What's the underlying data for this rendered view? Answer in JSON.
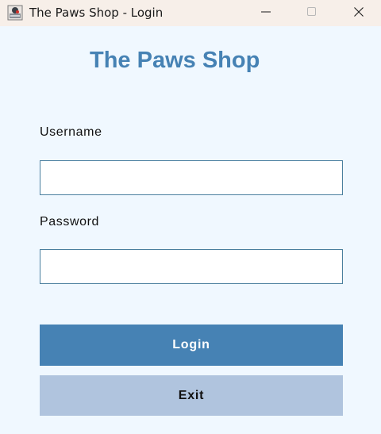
{
  "window": {
    "title": "The Paws Shop - Login"
  },
  "header": {
    "title": "The Paws Shop"
  },
  "form": {
    "username_label": "Username",
    "username_value": "",
    "password_label": "Password",
    "password_value": ""
  },
  "buttons": {
    "login_label": "Login",
    "exit_label": "Exit"
  },
  "colors": {
    "background": "#f0f8ff",
    "accent": "#4682b4",
    "secondary": "#b0c4de",
    "input_border": "#4a7f9f"
  },
  "icons": {
    "app": "app-icon",
    "minimize": "minimize-icon",
    "maximize": "maximize-icon",
    "close": "close-icon"
  }
}
